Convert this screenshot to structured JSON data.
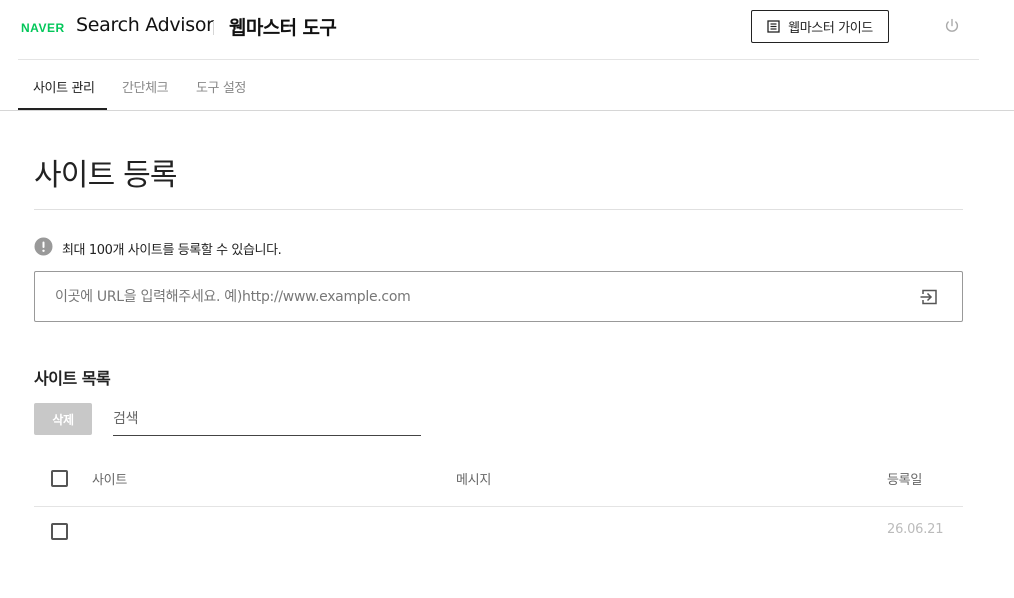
{
  "header": {
    "logo": "NAVER",
    "product": "Search Advisor",
    "tool": "웹마스터 도구",
    "guide_button": "웹마스터 가이드"
  },
  "tabs": [
    {
      "label": "사이트 관리",
      "active": true
    },
    {
      "label": "간단체크",
      "active": false
    },
    {
      "label": "도구 설정",
      "active": false
    }
  ],
  "page": {
    "title": "사이트 등록",
    "notice": "최대 100개 사이트를 등록할 수 있습니다.",
    "url_placeholder": "이곳에 URL을 입력해주세요. 예)http://www.example.com"
  },
  "site_list": {
    "title": "사이트 목록",
    "delete_button": "삭제",
    "search_placeholder": "검색",
    "columns": {
      "site": "사이트",
      "message": "메시지",
      "registered": "등록일"
    },
    "rows": [
      {
        "site": "",
        "message": "",
        "registered": "26.06.21"
      }
    ]
  },
  "colors": {
    "brand": "#03c75a",
    "disabled_button": "#c8c8c8",
    "notice_icon": "#999999"
  }
}
